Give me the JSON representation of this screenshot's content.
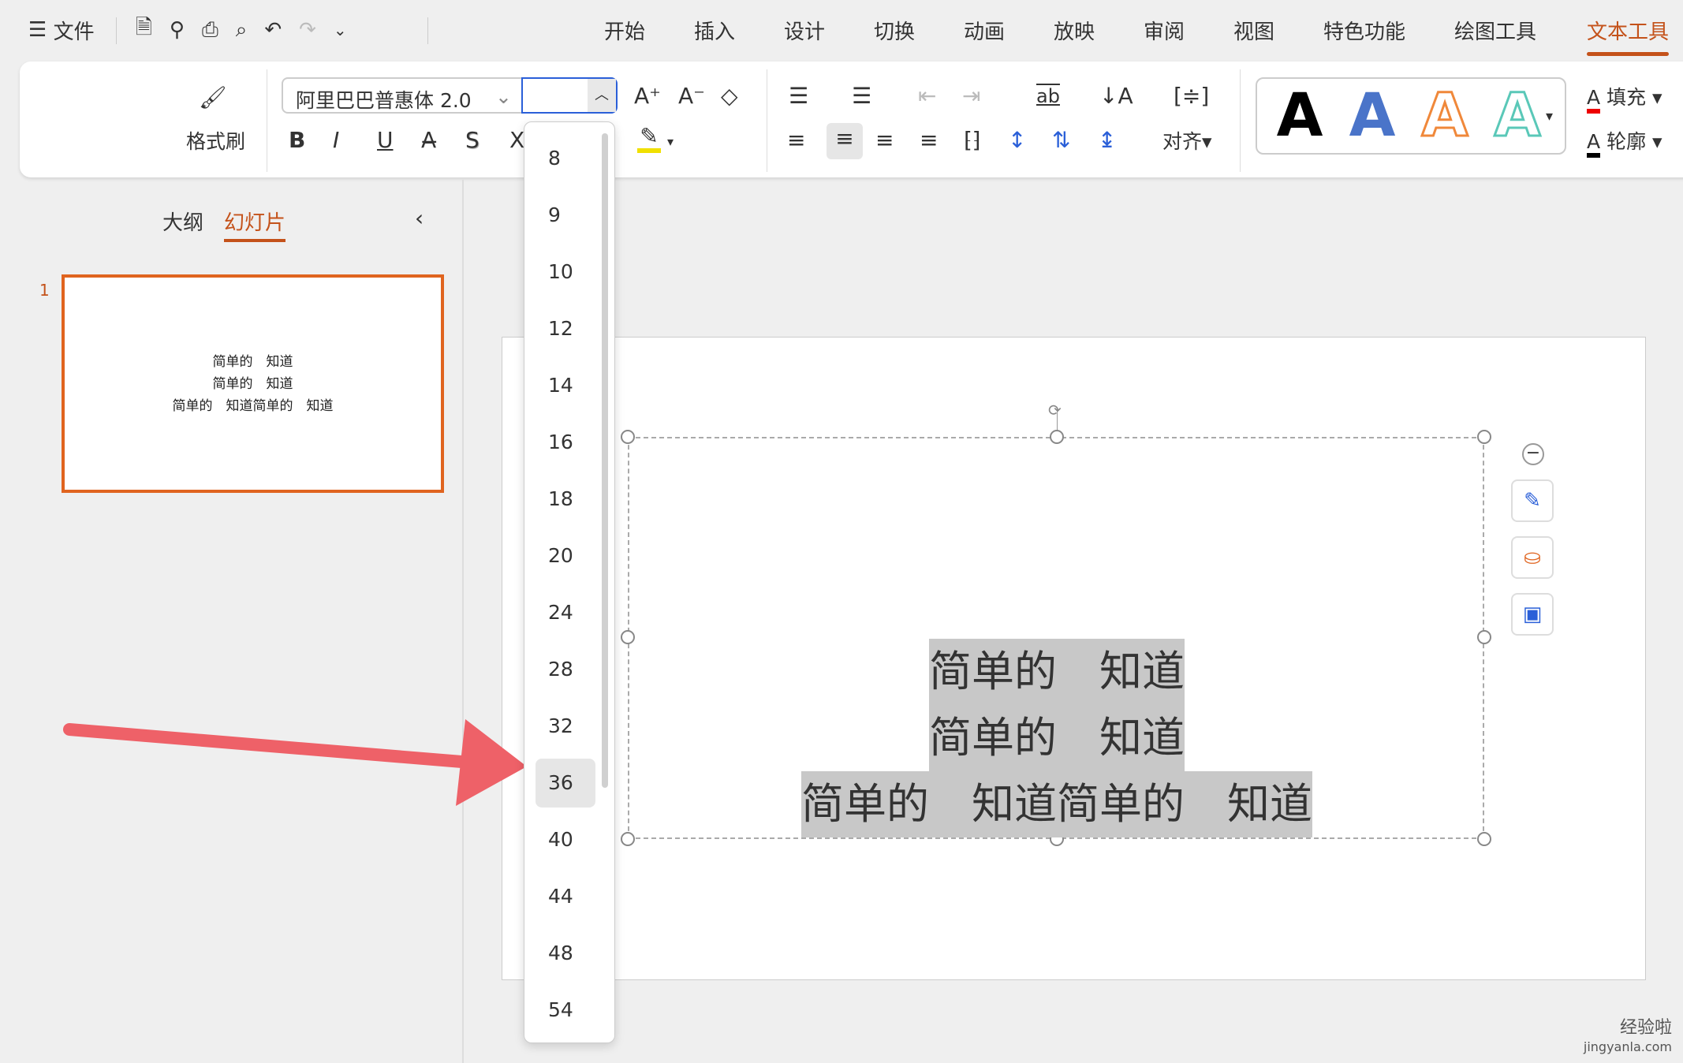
{
  "quick_access": {
    "menu_label": "文件"
  },
  "tabs": [
    {
      "label": "开始"
    },
    {
      "label": "插入"
    },
    {
      "label": "设计"
    },
    {
      "label": "切换"
    },
    {
      "label": "动画"
    },
    {
      "label": "放映"
    },
    {
      "label": "审阅"
    },
    {
      "label": "视图"
    },
    {
      "label": "特色功能"
    },
    {
      "label": "绘图工具"
    },
    {
      "label": "文本工具",
      "active": true
    }
  ],
  "ribbon": {
    "format_painter": "格式刷",
    "font_name": "阿里巴巴普惠体 2.0",
    "font_size": "",
    "align_label": "对齐",
    "fill_label": "填充",
    "outline_label": "轮廓",
    "wordart_styles": [
      {
        "glyph": "A",
        "color": "#000000"
      },
      {
        "glyph": "A",
        "color": "#4a74c9"
      },
      {
        "glyph": "A",
        "color": "#f0883a"
      },
      {
        "glyph": "A",
        "color": "#5ac8b8"
      }
    ]
  },
  "left_panel": {
    "tabs": [
      {
        "label": "大纲"
      },
      {
        "label": "幻灯片",
        "active": true
      }
    ],
    "slide_number": "1",
    "thumb_lines": [
      "简单的　知道",
      "简单的　知道",
      "简单的　知道简单的　知道"
    ]
  },
  "slide": {
    "lines": [
      "简单的　知道",
      "简单的　知道",
      "简单的　知道简单的　知道"
    ]
  },
  "font_size_dropdown": {
    "options": [
      "8",
      "9",
      "10",
      "12",
      "14",
      "16",
      "18",
      "20",
      "24",
      "28",
      "32",
      "36",
      "40",
      "44",
      "48",
      "54"
    ],
    "selected": "36"
  },
  "colors": {
    "accent": "#c4521a",
    "arrow": "#ee6168",
    "selection": "#c8c8c8"
  },
  "watermark": {
    "line1": "经验啦",
    "line2": "jingyanla.com"
  }
}
